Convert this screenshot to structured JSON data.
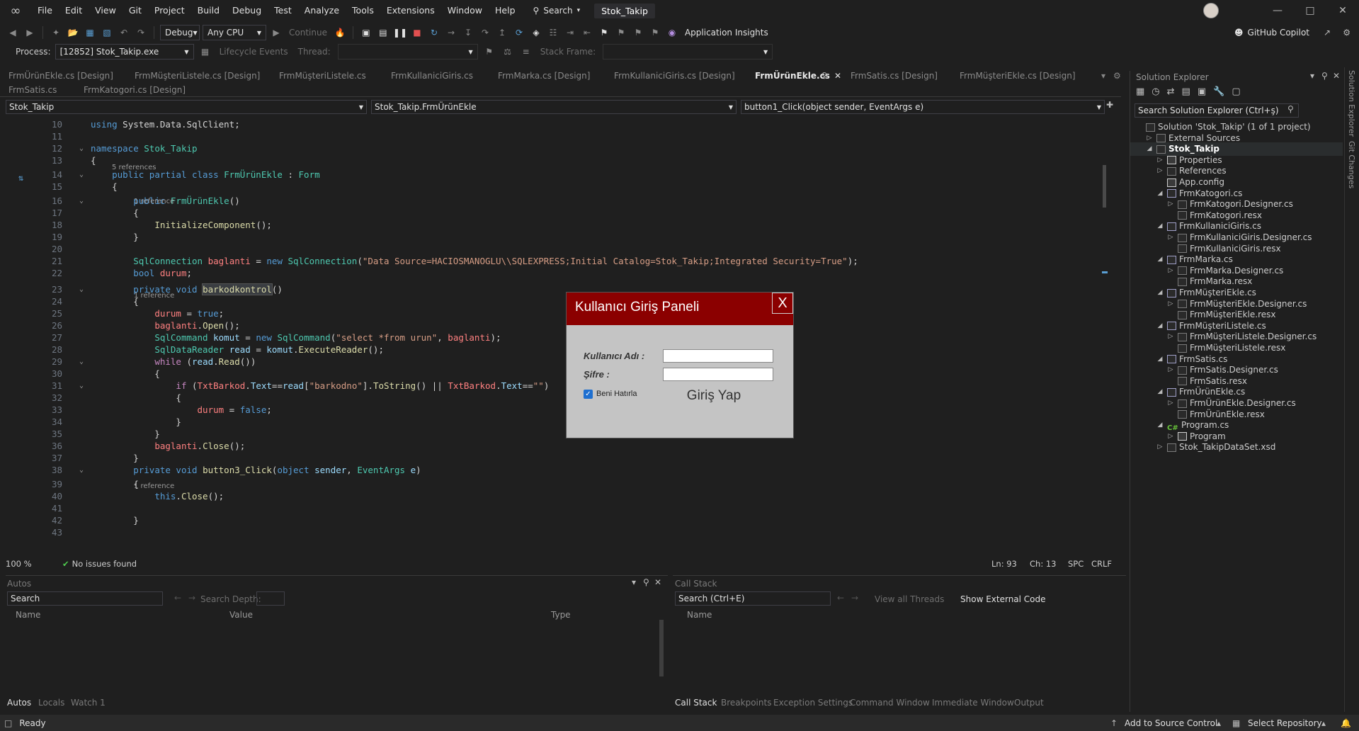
{
  "menubar": {
    "items": [
      "File",
      "Edit",
      "View",
      "Git",
      "Project",
      "Build",
      "Debug",
      "Test",
      "Analyze",
      "Tools",
      "Extensions",
      "Window",
      "Help"
    ],
    "search_label": "Search",
    "solution_name": "Stok_Takip"
  },
  "toolbar": {
    "config": "Debug",
    "platform": "Any CPU",
    "continue_label": "Continue",
    "app_insights": "Application Insights",
    "copilot": "GitHub Copilot"
  },
  "processbar": {
    "process_label": "Process:",
    "process_value": "[12852] Stok_Takip.exe",
    "lifecycle": "Lifecycle Events",
    "thread_label": "Thread:",
    "stack_frame_label": "Stack Frame:"
  },
  "doc_tabs": [
    "FrmÜrünEkle.cs [Design]",
    "FrmMüşteriListele.cs [Design]",
    "FrmMüşteriListele.cs",
    "FrmKullaniciGiris.cs",
    "FrmMarka.cs [Design]",
    "FrmKullaniciGiris.cs [Design]",
    "FrmÜrünEkle.cs",
    "FrmSatis.cs [Design]",
    "FrmMüşteriEkle.cs [Design]",
    "FrmSatis.cs",
    "FrmKatogori.cs [Design]"
  ],
  "navbar": {
    "project": "Stok_Takip",
    "class": "Stok_Takip.FrmÜrünEkle",
    "member": "button1_Click(object sender, EventArgs e)"
  },
  "code_lines": [
    {
      "n": "10",
      "html": "<span class='kw'>using</span> System.Data.SqlClient;"
    },
    {
      "n": "11",
      "html": ""
    },
    {
      "n": "12",
      "html": "<span class='kw'>namespace</span> <span class='ty'>Stok_Takip</span>"
    },
    {
      "n": "13",
      "html": "{"
    },
    {
      "n": "14",
      "html": "    <span class='kw'>public partial class</span> <span class='ty'>FrmÜrünEkle</span> : <span class='ty'>Form</span>"
    },
    {
      "n": "15",
      "html": "    {"
    },
    {
      "n": "16",
      "html": "        <span class='kw'>public</span> <span class='ty'>FrmÜrünEkle</span>()"
    },
    {
      "n": "17",
      "html": "        {"
    },
    {
      "n": "18",
      "html": "            <span class='fn'>InitializeComponent</span>();"
    },
    {
      "n": "19",
      "html": "        }"
    },
    {
      "n": "20",
      "html": ""
    },
    {
      "n": "21",
      "html": "        <span class='ty'>SqlConnection</span> <span class='vr'>baglanti</span> = <span class='kw'>new</span> <span class='ty'>SqlConnection</span>(<span class='str'>\"Data Source=HACIOSMANOGLU\\\\SQLEXPRESS;Initial Catalog=Stok_Takip;Integrated Security=True\"</span>);"
    },
    {
      "n": "22",
      "html": "        <span class='kw'>bool</span> <span class='vr'>durum</span>;"
    },
    {
      "n": "23",
      "html": "        <span class='kw'>private void</span> <span class='fn hl'>barkodkontrol</span>()"
    },
    {
      "n": "24",
      "html": "        {"
    },
    {
      "n": "25",
      "html": "            <span class='vr'>durum</span> = <span class='kw'>true</span>;"
    },
    {
      "n": "26",
      "html": "            <span class='vr'>baglanti</span>.<span class='fn'>Open</span>();"
    },
    {
      "n": "27",
      "html": "            <span class='ty'>SqlCommand</span> <span class='pn'>komut</span> = <span class='kw'>new</span> <span class='ty'>SqlCommand</span>(<span class='str'>\"select *from urun\"</span>, <span class='vr'>baglanti</span>);"
    },
    {
      "n": "28",
      "html": "            <span class='ty'>SqlDataReader</span> <span class='pn'>read</span> = <span class='pn'>komut</span>.<span class='fn'>ExecuteReader</span>();"
    },
    {
      "n": "29",
      "html": "            <span class='kw2'>while</span> (<span class='pn'>read</span>.<span class='fn'>Read</span>())"
    },
    {
      "n": "30",
      "html": "            {"
    },
    {
      "n": "31",
      "html": "                <span class='kw2'>if</span> (<span class='vr'>TxtBarkod</span>.<span class='pn'>Text</span>==<span class='pn'>read</span>[<span class='str'>\"barkodno\"</span>].<span class='fn'>ToString</span>() || <span class='vr'>TxtBarkod</span>.<span class='pn'>Text</span>==<span class='str'>\"\"</span>)"
    },
    {
      "n": "32",
      "html": "                {"
    },
    {
      "n": "33",
      "html": "                    <span class='vr'>durum</span> = <span class='kw'>false</span>;"
    },
    {
      "n": "34",
      "html": "                }"
    },
    {
      "n": "35",
      "html": "            }"
    },
    {
      "n": "36",
      "html": "            <span class='vr'>baglanti</span>.<span class='fn'>Close</span>();"
    },
    {
      "n": "37",
      "html": "        }"
    },
    {
      "n": "38",
      "html": "        <span class='kw'>private void</span> <span class='fn'>button3_Click</span>(<span class='kw'>object</span> <span class='pn'>sender</span>, <span class='ty'>EventArgs</span> <span class='pn'>e</span>)"
    },
    {
      "n": "39",
      "html": "        {"
    },
    {
      "n": "40",
      "html": "            <span class='kw'>this</span>.<span class='fn'>Close</span>();"
    },
    {
      "n": "41",
      "html": ""
    },
    {
      "n": "42",
      "html": "        }"
    },
    {
      "n": "43",
      "html": ""
    }
  ],
  "code_refs": {
    "class_refs": "5 references",
    "ctor_refs": "1 reference",
    "barkod_refs": "1 reference",
    "button3_refs": "1 reference"
  },
  "editor_status": {
    "zoom": "100 %",
    "issues": "No issues found",
    "ln": "Ln: 93",
    "ch": "Ch: 13",
    "spc": "SPC",
    "crlf": "CRLF"
  },
  "autos": {
    "title": "Autos",
    "search_placeholder": "Search",
    "search_depth": "Search Depth:",
    "col_name": "Name",
    "col_value": "Value",
    "col_type": "Type",
    "tabs": [
      "Autos",
      "Locals",
      "Watch 1"
    ]
  },
  "callstack": {
    "title": "Call Stack",
    "search_placeholder": "Search (Ctrl+E)",
    "view_threads": "View all Threads",
    "show_external": "Show External Code",
    "col_name": "Name",
    "tabs": [
      "Call Stack",
      "Breakpoints",
      "Exception Settings",
      "Command Window",
      "Immediate Window",
      "Output"
    ]
  },
  "solution_explorer": {
    "title": "Solution Explorer",
    "search_placeholder": "Search Solution Explorer (Ctrl+ş)",
    "items": [
      {
        "label": "Solution 'Stok_Takip' (1 of 1 project)",
        "indent": 0,
        "tw": "",
        "icon": "sln"
      },
      {
        "label": "External Sources",
        "indent": 1,
        "tw": "▷",
        "icon": "res"
      },
      {
        "label": "Stok_Takip",
        "indent": 1,
        "tw": "◢",
        "icon": "proj",
        "sel": true
      },
      {
        "label": "Properties",
        "indent": 2,
        "tw": "▷",
        "icon": "cfg"
      },
      {
        "label": "References",
        "indent": 2,
        "tw": "▷",
        "icon": "res"
      },
      {
        "label": "App.config",
        "indent": 2,
        "tw": "",
        "icon": "cfg"
      },
      {
        "label": "FrmKatogori.cs",
        "indent": 2,
        "tw": "◢",
        "icon": "form"
      },
      {
        "label": "FrmKatogori.Designer.cs",
        "indent": 3,
        "tw": "▷",
        "icon": "res"
      },
      {
        "label": "FrmKatogori.resx",
        "indent": 3,
        "tw": "",
        "icon": "res"
      },
      {
        "label": "FrmKullaniciGiris.cs",
        "indent": 2,
        "tw": "◢",
        "icon": "form"
      },
      {
        "label": "FrmKullaniciGiris.Designer.cs",
        "indent": 3,
        "tw": "▷",
        "icon": "res"
      },
      {
        "label": "FrmKullaniciGiris.resx",
        "indent": 3,
        "tw": "",
        "icon": "res"
      },
      {
        "label": "FrmMarka.cs",
        "indent": 2,
        "tw": "◢",
        "icon": "form"
      },
      {
        "label": "FrmMarka.Designer.cs",
        "indent": 3,
        "tw": "▷",
        "icon": "res"
      },
      {
        "label": "FrmMarka.resx",
        "indent": 3,
        "tw": "",
        "icon": "res"
      },
      {
        "label": "FrmMüşteriEkle.cs",
        "indent": 2,
        "tw": "◢",
        "icon": "form"
      },
      {
        "label": "FrmMüşteriEkle.Designer.cs",
        "indent": 3,
        "tw": "▷",
        "icon": "res"
      },
      {
        "label": "FrmMüşteriEkle.resx",
        "indent": 3,
        "tw": "",
        "icon": "res"
      },
      {
        "label": "FrmMüşteriListele.cs",
        "indent": 2,
        "tw": "◢",
        "icon": "form"
      },
      {
        "label": "FrmMüşteriListele.Designer.cs",
        "indent": 3,
        "tw": "▷",
        "icon": "res"
      },
      {
        "label": "FrmMüşteriListele.resx",
        "indent": 3,
        "tw": "",
        "icon": "res"
      },
      {
        "label": "FrmSatis.cs",
        "indent": 2,
        "tw": "◢",
        "icon": "form"
      },
      {
        "label": "FrmSatis.Designer.cs",
        "indent": 3,
        "tw": "▷",
        "icon": "res"
      },
      {
        "label": "FrmSatis.resx",
        "indent": 3,
        "tw": "",
        "icon": "res"
      },
      {
        "label": "FrmÜrünEkle.cs",
        "indent": 2,
        "tw": "◢",
        "icon": "form"
      },
      {
        "label": "FrmÜrünEkle.Designer.cs",
        "indent": 3,
        "tw": "▷",
        "icon": "res"
      },
      {
        "label": "FrmÜrünEkle.resx",
        "indent": 3,
        "tw": "",
        "icon": "res"
      },
      {
        "label": "Program.cs",
        "indent": 2,
        "tw": "◢",
        "icon": "cs"
      },
      {
        "label": "Program",
        "indent": 3,
        "tw": "▷",
        "icon": "cfg"
      },
      {
        "label": "Stok_TakipDataSet.xsd",
        "indent": 2,
        "tw": "▷",
        "icon": "res"
      }
    ]
  },
  "right_strip": [
    "Solution Explorer",
    "Git Changes"
  ],
  "statusbar": {
    "ready": "Ready",
    "source_control": "Add to Source Control",
    "select_repo": "Select Repository"
  },
  "login_dialog": {
    "title": "Kullanıcı Giriş Paneli",
    "close": "X",
    "username_label": "Kullanıcı Adı :",
    "password_label": "Şifre :",
    "remember_label": "Beni Hatırla",
    "login_button": "Giriş Yap",
    "accent": "#8b0000"
  }
}
